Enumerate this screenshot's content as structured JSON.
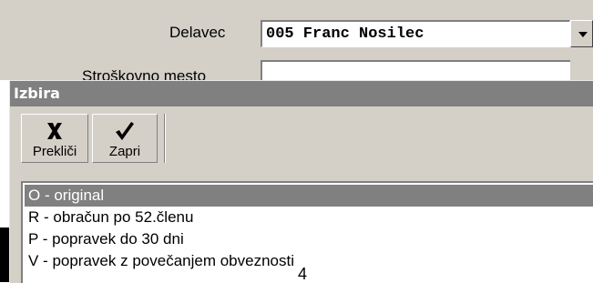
{
  "form": {
    "worker_label": "Delavec",
    "worker_value": "005 Franc Nosilec",
    "cost_center_label": "Stroškovno mesto",
    "cost_center_value": ""
  },
  "dialog": {
    "title": "Izbira",
    "toolbar": {
      "cancel_label": "Prekliči",
      "cancel_icon": "x-icon",
      "close_label": "Zapri",
      "close_icon": "checkmark-icon"
    },
    "options": [
      {
        "label": "O - original",
        "selected": true
      },
      {
        "label": "R - obračun po 52.členu",
        "selected": false
      },
      {
        "label": "P - popravek do 30 dni",
        "selected": false
      },
      {
        "label": "V - popravek z povečanjem obveznosti",
        "selected": false
      }
    ]
  },
  "page_number": "4",
  "colors": {
    "window_bg": "#d4d0c8",
    "titlebar": "#808080",
    "selection": "#808080"
  }
}
